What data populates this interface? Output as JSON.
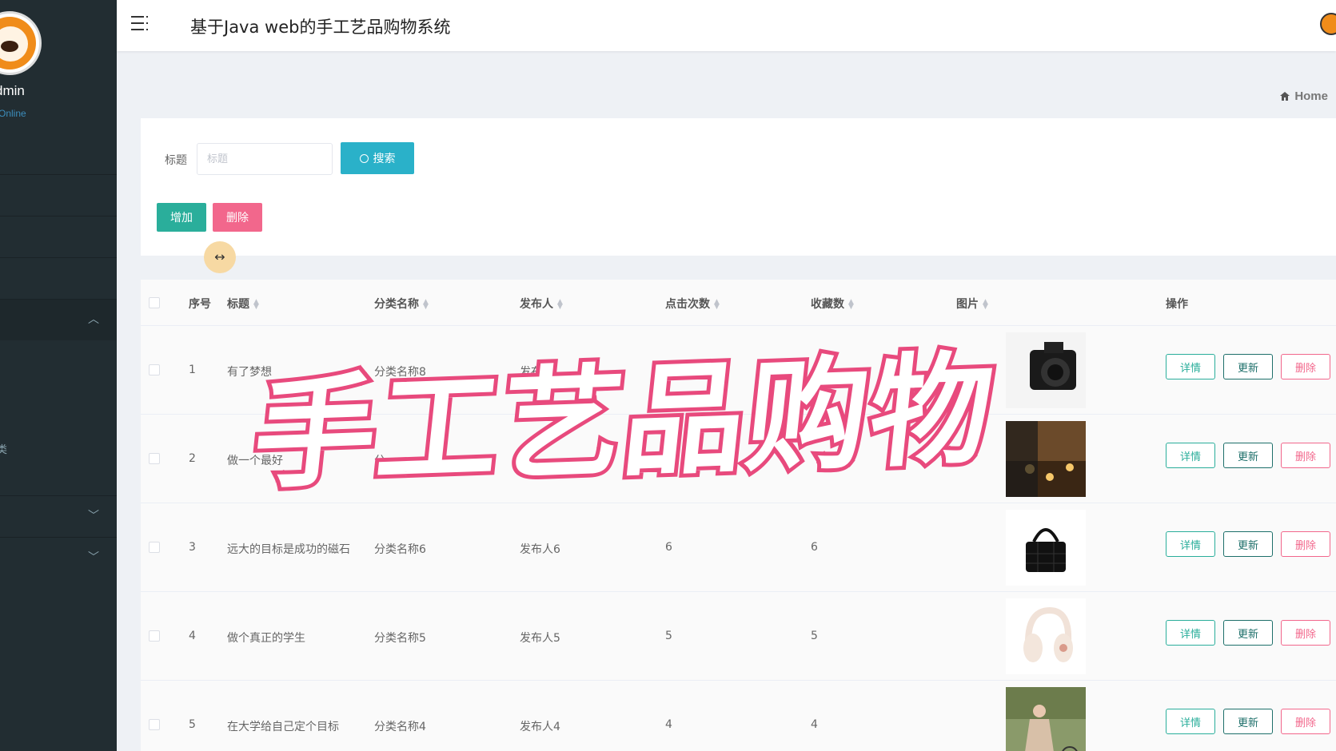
{
  "sidebar": {
    "user_name": "dmin",
    "user_status": "Online",
    "partial_label": "类"
  },
  "header": {
    "title": "基于Java web的手工艺品购物系统"
  },
  "breadcrumb": {
    "home": "Home"
  },
  "search": {
    "label": "标题",
    "placeholder": "标题",
    "search_button": "搜索",
    "add_button": "增加",
    "delete_button": "删除"
  },
  "table": {
    "headers": [
      "序号",
      "标题",
      "分类名称",
      "发布人",
      "点击次数",
      "收藏数",
      "图片",
      "操作"
    ],
    "rows": [
      {
        "index": "1",
        "title": "有了梦想",
        "category": "分类名称8",
        "publisher": "发布",
        "clicks": "",
        "favorites": "",
        "image": "camera"
      },
      {
        "index": "2",
        "title": "做一个最好",
        "category": "分",
        "publisher": "发",
        "clicks": "",
        "favorites": "",
        "image": "lamp"
      },
      {
        "index": "3",
        "title": "远大的目标是成功的磁石",
        "category": "分类名称6",
        "publisher": "发布人6",
        "clicks": "6",
        "favorites": "6",
        "image": "handbag"
      },
      {
        "index": "4",
        "title": "做个真正的学生",
        "category": "分类名称5",
        "publisher": "发布人5",
        "clicks": "5",
        "favorites": "5",
        "image": "headphones"
      },
      {
        "index": "5",
        "title": "在大学给自己定个目标",
        "category": "分类名称4",
        "publisher": "发布人4",
        "clicks": "4",
        "favorites": "4",
        "image": "portrait"
      }
    ],
    "actions": {
      "detail": "详情",
      "update": "更新",
      "delete": "删除"
    }
  },
  "overlay": {
    "text": "手工艺品购物"
  },
  "colors": {
    "sidebar_bg": "#222d32",
    "search_btn": "#2ab1c9",
    "add_btn": "#2aae9b",
    "delete_btn": "#f2678c",
    "overlay_stroke": "#e84a7d"
  }
}
